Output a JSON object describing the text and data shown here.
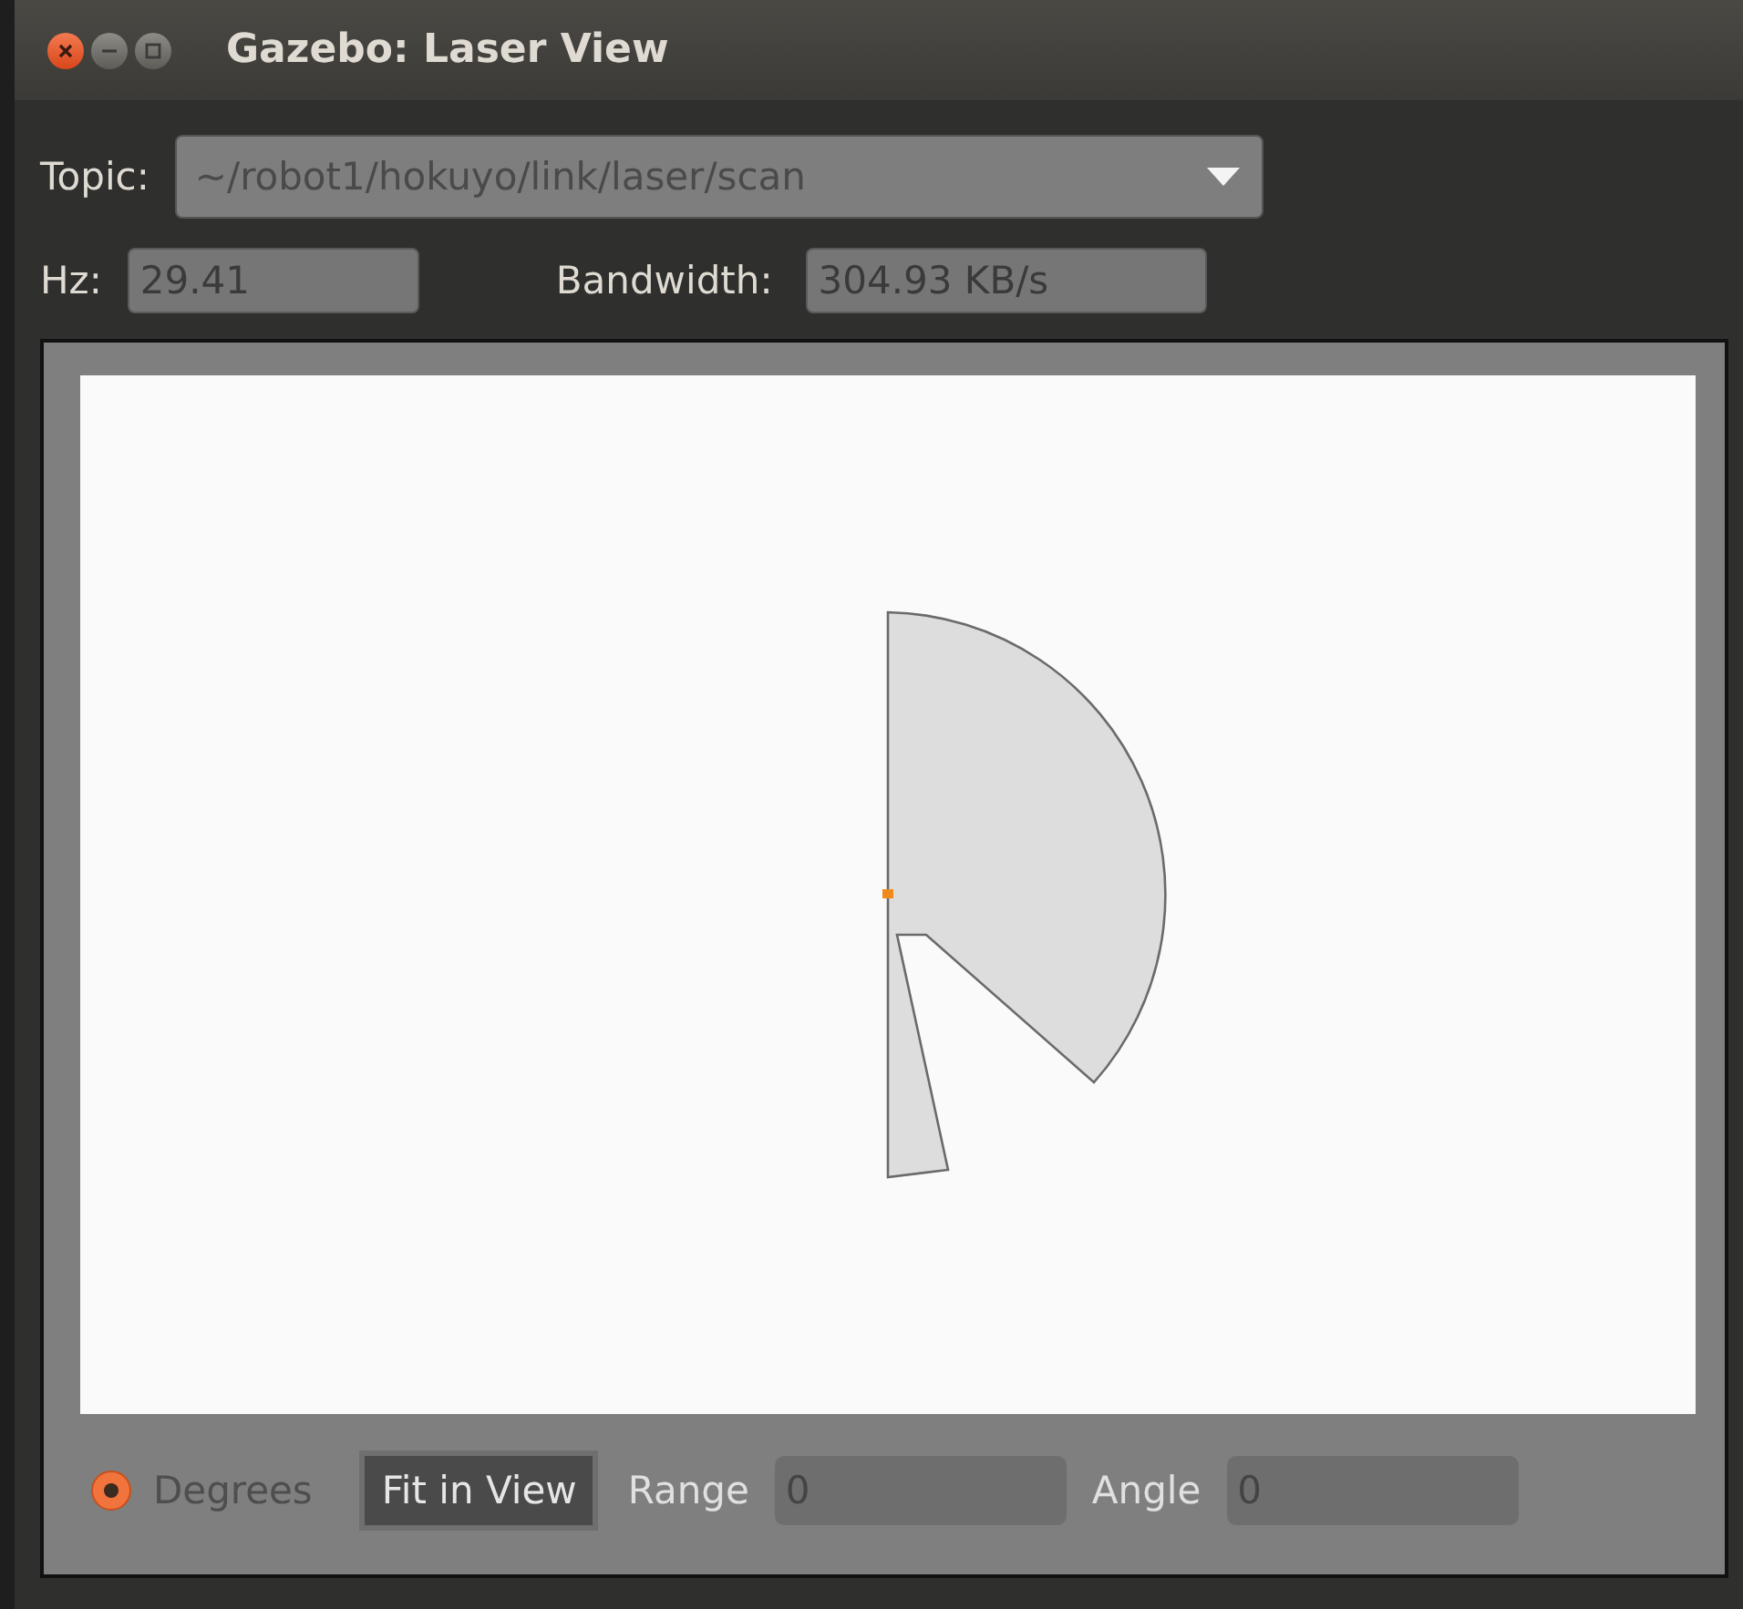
{
  "window": {
    "title": "Gazebo: Laser View"
  },
  "topic": {
    "label": "Topic:",
    "value": "~/robot1/hokuyo/link/laser/scan"
  },
  "hz": {
    "label": "Hz:",
    "value": "29.41"
  },
  "bandwidth": {
    "label": "Bandwidth:",
    "value": "304.93 KB/s"
  },
  "controls": {
    "degrees": {
      "label": "Degrees",
      "selected": true
    },
    "fit_button": "Fit in View",
    "range": {
      "label": "Range",
      "value": "0"
    },
    "angle": {
      "label": "Angle",
      "value": "0"
    }
  }
}
